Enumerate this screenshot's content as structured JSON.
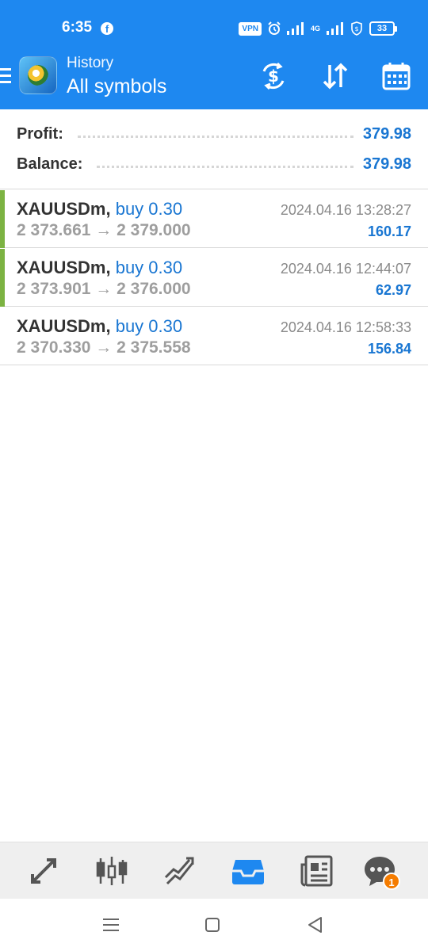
{
  "status_bar": {
    "time": "6:35",
    "vpn_label": "VPN",
    "network_label": "4G",
    "battery": "33"
  },
  "app_bar": {
    "subtitle": "History",
    "title": "All symbols",
    "actions": [
      "currency-exchange-icon",
      "sort-icon",
      "calendar-icon"
    ]
  },
  "summary": {
    "profit_label": "Profit:",
    "profit_value": "379.98",
    "balance_label": "Balance:",
    "balance_value": "379.98"
  },
  "trades": [
    {
      "symbol": "XAUUSDm,",
      "side": "buy 0.30",
      "open_price": "2 373.661",
      "arrow": "→",
      "close_price": "2 379.000",
      "time": "2024.04.16 13:28:27",
      "profit": "160.17"
    },
    {
      "symbol": "XAUUSDm,",
      "side": "buy 0.30",
      "open_price": "2 373.901",
      "arrow": "→",
      "close_price": "2 376.000",
      "time": "2024.04.16 12:44:07",
      "profit": "62.97"
    },
    {
      "symbol": "XAUUSDm,",
      "side": "buy 0.30",
      "open_price": "2 370.330",
      "arrow": "→",
      "close_price": "2 375.558",
      "time": "2024.04.16 12:58:33",
      "profit": "156.84"
    }
  ],
  "bottom_nav": {
    "items": [
      "quotes-icon",
      "chart-icon",
      "trade-icon",
      "history-icon",
      "news-icon",
      "chat-icon"
    ],
    "active": "history-icon",
    "chat_badge": "1"
  },
  "colors": {
    "primary": "#1e88f0",
    "value_blue": "#1976d2",
    "accent_green": "#7cb342",
    "badge_orange": "#f57c00"
  }
}
